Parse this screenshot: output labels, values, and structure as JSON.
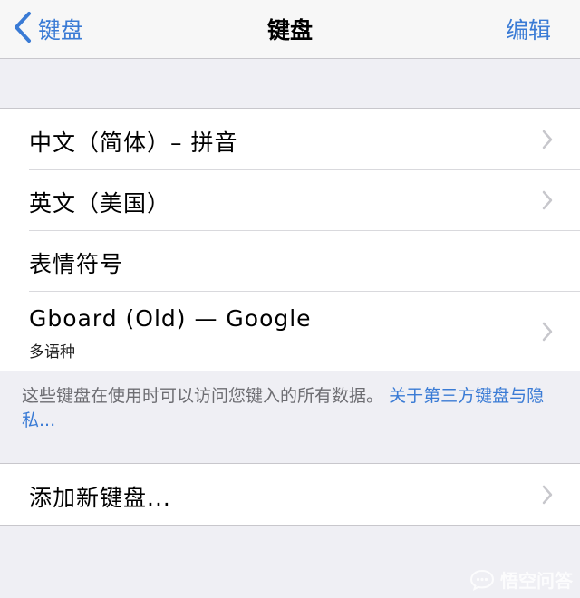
{
  "navbar": {
    "back_label": "键盘",
    "title": "键盘",
    "edit_label": "编辑"
  },
  "keyboards": [
    {
      "label": "中文（简体）– 拼音",
      "has_chevron": true
    },
    {
      "label": "英文（美国）",
      "has_chevron": true
    },
    {
      "label": "表情符号",
      "has_chevron": false
    },
    {
      "label": "Gboard (Old) — Google",
      "sublabel": "多语种",
      "has_chevron": true
    }
  ],
  "footer": {
    "text": "这些键盘在使用时可以访问您键入的所有数据。",
    "link": "关于第三方键盘与隐私..."
  },
  "add_keyboard": {
    "label": "添加新键盘..."
  },
  "watermark": {
    "text": "悟空问答"
  },
  "colors": {
    "accent": "#3a7bd5",
    "background": "#efeff4",
    "separator": "#c8c7cc",
    "chevron": "#c7c7cc"
  }
}
